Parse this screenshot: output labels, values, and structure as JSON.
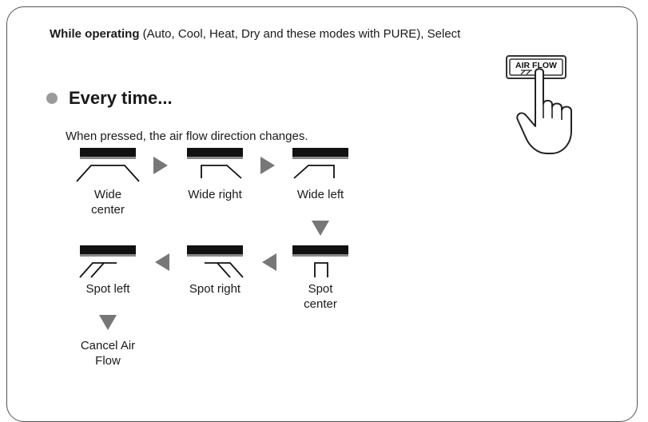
{
  "instruction": {
    "bold": "While operating",
    "rest": " (Auto, Cool, Heat, Dry and these modes with PURE), Select"
  },
  "button": {
    "label": "AIR FLOW"
  },
  "section": {
    "heading": "Every time...",
    "description": "When pressed, the air flow direction changes."
  },
  "positions": [
    {
      "line1": "Wide",
      "line2": "center",
      "icon": "wide-center-icon"
    },
    {
      "line1": "Wide right",
      "line2": "",
      "icon": "wide-right-icon"
    },
    {
      "line1": "Wide left",
      "line2": "",
      "icon": "wide-left-icon"
    },
    {
      "line1": "Spot",
      "line2": "center",
      "icon": "spot-center-icon"
    },
    {
      "line1": "Spot right",
      "line2": "",
      "icon": "spot-right-icon"
    },
    {
      "line1": "Spot left",
      "line2": "",
      "icon": "spot-left-icon"
    },
    {
      "line1": "Cancel Air",
      "line2": "Flow",
      "icon": ""
    }
  ]
}
